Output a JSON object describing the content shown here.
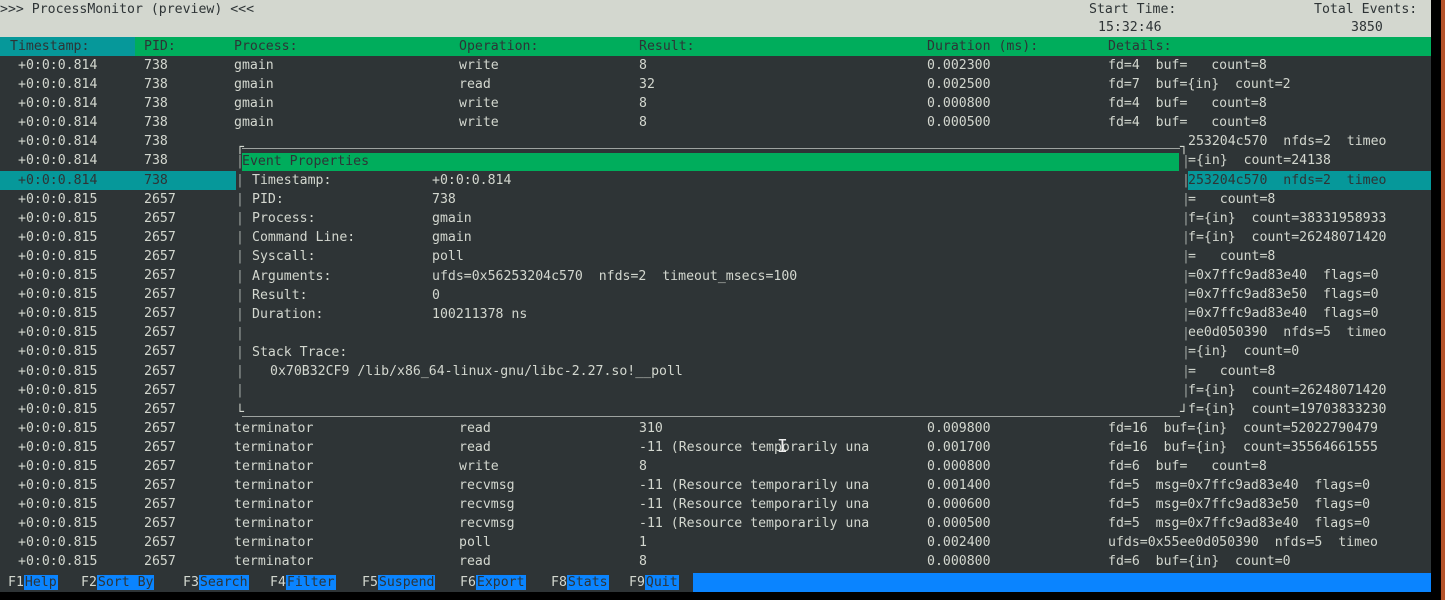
{
  "header": {
    "title": ">>> ProcessMonitor (preview) <<<",
    "start_time_label": "Start Time:",
    "start_time_value": "15:32:46",
    "total_events_label": "Total Events:",
    "total_events_value": "3850"
  },
  "columns": [
    "Timestamp:",
    "PID:",
    "Process:",
    "Operation:",
    "Result:",
    "Duration (ms):",
    "Details:"
  ],
  "sorted_column": "Timestamp:",
  "rows": [
    {
      "ts": "+0:0:0.814",
      "pid": "738",
      "proc": "gmain",
      "op": "write",
      "res": "8",
      "dur": "0.002300",
      "det": "fd=4  buf=   count=8"
    },
    {
      "ts": "+0:0:0.814",
      "pid": "738",
      "proc": "gmain",
      "op": "read",
      "res": "32",
      "dur": "0.002500",
      "det": "fd=7  buf={in}  count=2"
    },
    {
      "ts": "+0:0:0.814",
      "pid": "738",
      "proc": "gmain",
      "op": "write",
      "res": "8",
      "dur": "0.000800",
      "det": "fd=4  buf=   count=8"
    },
    {
      "ts": "+0:0:0.814",
      "pid": "738",
      "proc": "gmain",
      "op": "write",
      "res": "8",
      "dur": "0.000500",
      "det": "fd=4  buf=   count=8"
    },
    {
      "ts": "+0:0:0.814",
      "pid": "738",
      "proc": "",
      "op": "",
      "res": "",
      "dur": "",
      "det": "253204c570  nfds=2  timeo"
    },
    {
      "ts": "+0:0:0.814",
      "pid": "738",
      "proc": "",
      "op": "",
      "res": "",
      "dur": "",
      "det": "={in}  count=24138"
    },
    {
      "ts": "+0:0:0.814",
      "pid": "738",
      "proc": "",
      "op": "",
      "res": "",
      "dur": "",
      "det": "253204c570  nfds=2  timeo",
      "selected": true
    },
    {
      "ts": "+0:0:0.815",
      "pid": "2657",
      "proc": "",
      "op": "",
      "res": "",
      "dur": "",
      "det": "=   count=8"
    },
    {
      "ts": "+0:0:0.815",
      "pid": "2657",
      "proc": "",
      "op": "",
      "res": "",
      "dur": "",
      "det": "f={in}  count=38331958933"
    },
    {
      "ts": "+0:0:0.815",
      "pid": "2657",
      "proc": "",
      "op": "",
      "res": "",
      "dur": "",
      "det": "f={in}  count=26248071420"
    },
    {
      "ts": "+0:0:0.815",
      "pid": "2657",
      "proc": "",
      "op": "",
      "res": "",
      "dur": "",
      "det": "=   count=8"
    },
    {
      "ts": "+0:0:0.815",
      "pid": "2657",
      "proc": "",
      "op": "",
      "res": "",
      "dur": "",
      "det": "=0x7ffc9ad83e40  flags=0"
    },
    {
      "ts": "+0:0:0.815",
      "pid": "2657",
      "proc": "",
      "op": "",
      "res": "",
      "dur": "",
      "det": "=0x7ffc9ad83e50  flags=0"
    },
    {
      "ts": "+0:0:0.815",
      "pid": "2657",
      "proc": "",
      "op": "",
      "res": "",
      "dur": "",
      "det": "=0x7ffc9ad83e40  flags=0"
    },
    {
      "ts": "+0:0:0.815",
      "pid": "2657",
      "proc": "",
      "op": "",
      "res": "",
      "dur": "",
      "det": "ee0d050390  nfds=5  timeo"
    },
    {
      "ts": "+0:0:0.815",
      "pid": "2657",
      "proc": "",
      "op": "",
      "res": "",
      "dur": "",
      "det": "={in}  count=0"
    },
    {
      "ts": "+0:0:0.815",
      "pid": "2657",
      "proc": "",
      "op": "",
      "res": "",
      "dur": "",
      "det": "=   count=8"
    },
    {
      "ts": "+0:0:0.815",
      "pid": "2657",
      "proc": "",
      "op": "",
      "res": "",
      "dur": "",
      "det": "f={in}  count=26248071420"
    },
    {
      "ts": "+0:0:0.815",
      "pid": "2657",
      "proc": "",
      "op": "",
      "res": "",
      "dur": "",
      "det": "f={in}  count=19703833230"
    },
    {
      "ts": "+0:0:0.815",
      "pid": "2657",
      "proc": "terminator",
      "op": "read",
      "res": "310",
      "dur": "0.009800",
      "det": "fd=16  buf={in}  count=52022790479"
    },
    {
      "ts": "+0:0:0.815",
      "pid": "2657",
      "proc": "terminator",
      "op": "read",
      "res": "-11 (Resource temporarily una",
      "dur": "0.001700",
      "det": "fd=16  buf={in}  count=35564661555"
    },
    {
      "ts": "+0:0:0.815",
      "pid": "2657",
      "proc": "terminator",
      "op": "write",
      "res": "8",
      "dur": "0.000800",
      "det": "fd=6  buf=   count=8"
    },
    {
      "ts": "+0:0:0.815",
      "pid": "2657",
      "proc": "terminator",
      "op": "recvmsg",
      "res": "-11 (Resource temporarily una",
      "dur": "0.001400",
      "det": "fd=5  msg=0x7ffc9ad83e40  flags=0"
    },
    {
      "ts": "+0:0:0.815",
      "pid": "2657",
      "proc": "terminator",
      "op": "recvmsg",
      "res": "-11 (Resource temporarily una",
      "dur": "0.000600",
      "det": "fd=5  msg=0x7ffc9ad83e50  flags=0"
    },
    {
      "ts": "+0:0:0.815",
      "pid": "2657",
      "proc": "terminator",
      "op": "recvmsg",
      "res": "-11 (Resource temporarily una",
      "dur": "0.000500",
      "det": "fd=5  msg=0x7ffc9ad83e40  flags=0"
    },
    {
      "ts": "+0:0:0.815",
      "pid": "2657",
      "proc": "terminator",
      "op": "poll",
      "res": "1",
      "dur": "0.002400",
      "det": "ufds=0x55ee0d050390  nfds=5  timeo"
    },
    {
      "ts": "+0:0:0.815",
      "pid": "2657",
      "proc": "terminator",
      "op": "read",
      "res": "8",
      "dur": "0.000800",
      "det": "fd=6  buf={in}  count=0"
    }
  ],
  "dialog": {
    "title": "Event Properties",
    "fields": [
      {
        "label": "Timestamp:",
        "value": "+0:0:0.814"
      },
      {
        "label": "PID:",
        "value": "738"
      },
      {
        "label": "Process:",
        "value": "gmain"
      },
      {
        "label": "Command Line:",
        "value": "gmain"
      },
      {
        "label": "Syscall:",
        "value": "poll"
      },
      {
        "label": "Arguments:",
        "value": "ufds=0x56253204c570  nfds=2  timeout_msecs=100"
      },
      {
        "label": "Result:",
        "value": "0"
      },
      {
        "label": "Duration:",
        "value": "100211378 ns"
      }
    ],
    "stack_trace_label": "Stack Trace:",
    "stack_trace": [
      "0x70B32CF9 /lib/x86_64-linux-gnu/libc-2.27.so!__poll"
    ]
  },
  "function_keys": [
    {
      "key": "F1",
      "label": "Help"
    },
    {
      "key": "F2",
      "label": "Sort By"
    },
    {
      "key": "F3",
      "label": "Search"
    },
    {
      "key": "F4",
      "label": "Filter"
    },
    {
      "key": "F5",
      "label": "Suspend"
    },
    {
      "key": "F6",
      "label": "Export"
    },
    {
      "key": "F8",
      "label": "Stats"
    },
    {
      "key": "F9",
      "label": "Quit"
    }
  ],
  "colors": {
    "header_bg": "#d3d7cf",
    "column_header_bg": "#00ad5c",
    "selected_bg": "#06989a",
    "terminal_bg": "#2e3436",
    "fkey_bg": "#0a84ff"
  }
}
